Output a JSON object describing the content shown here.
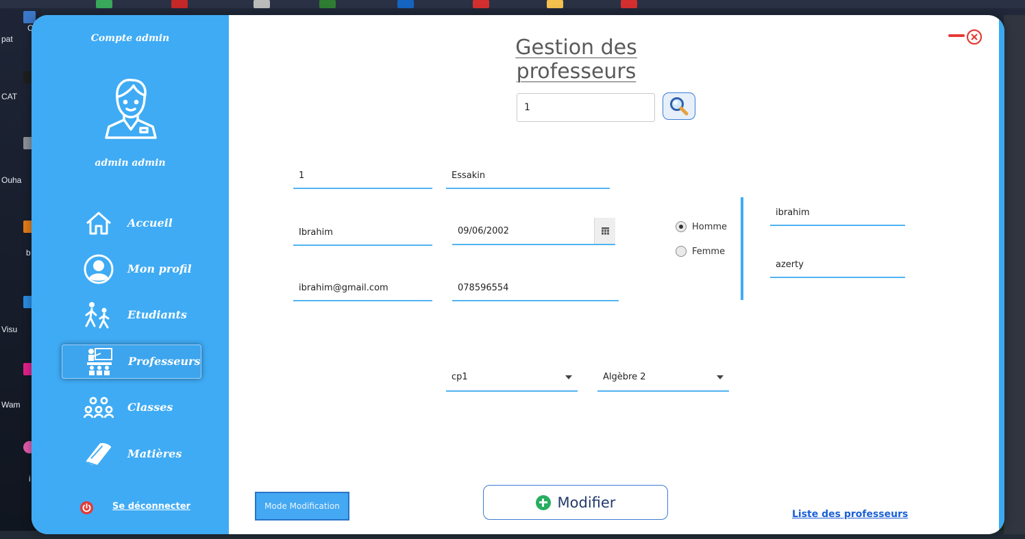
{
  "desktop": {
    "labels": [
      "C",
      "pat",
      "CAT",
      "Ouha",
      "b",
      "Visu",
      "Wam",
      "i"
    ]
  },
  "sidebar": {
    "account_title": "Compte admin",
    "username": "admin  admin",
    "active_item": "Professeurs",
    "items": [
      {
        "label": "Accueil",
        "icon": "home-icon"
      },
      {
        "label": "Mon profil",
        "icon": "user-circle-icon"
      },
      {
        "label": "Etudiants",
        "icon": "students-walking-icon"
      },
      {
        "label": "Professeurs",
        "icon": "teacher-board-icon"
      },
      {
        "label": "Classes",
        "icon": "group-icon"
      },
      {
        "label": "Matières",
        "icon": "book-icon"
      }
    ],
    "logout_label": "Se déconnecter"
  },
  "header": {
    "title": "Gestion des professeurs"
  },
  "search": {
    "value": "1"
  },
  "form": {
    "id": "1",
    "nom": "Essakin",
    "prenom": "Ibrahim",
    "date_naissance": "09/06/2002",
    "email": "ibrahim@gmail.com",
    "telephone": "078596554",
    "gender_options": [
      {
        "label": "Homme",
        "selected": true
      },
      {
        "label": "Femme",
        "selected": false
      }
    ],
    "login": "ibrahim",
    "password": "azerty",
    "classe": "cp1",
    "matiere": "Algèbre 2"
  },
  "actions": {
    "mode_label": "Mode Modification",
    "modify_label": "Modifier",
    "list_link": "Liste des professeurs"
  },
  "colors": {
    "sidebar": "#3fabf4",
    "accent": "#4fb3f2",
    "close_red": "#e53935",
    "modify_green": "#27ae60",
    "link_blue": "#1a5fd6"
  }
}
